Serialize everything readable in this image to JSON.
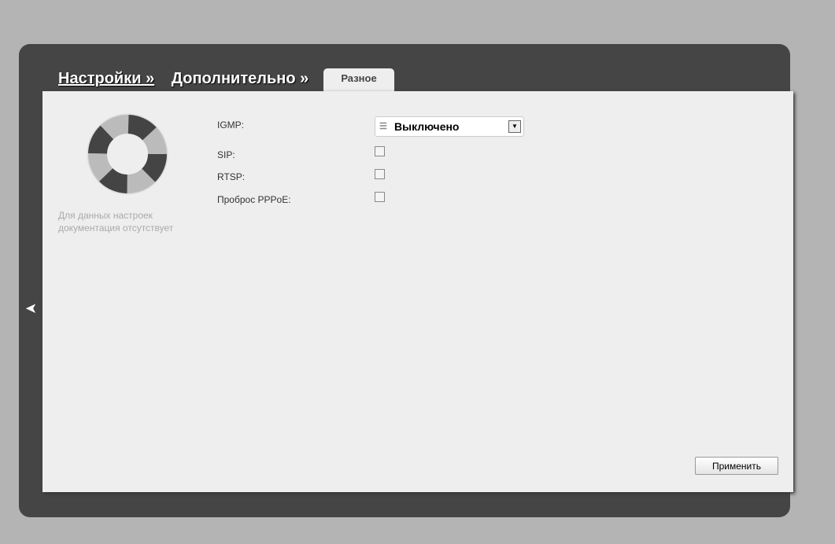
{
  "breadcrumb": {
    "item1": "Настройки »",
    "item2": "Дополнительно »"
  },
  "tab": "Разное",
  "help_note": "Для данных настроек документация отсутствует",
  "form": {
    "igmp_label": "IGMP:",
    "igmp_value": "Выключено",
    "sip_label": "SIP:",
    "rtsp_label": "RTSP:",
    "pppoe_label": "Проброс PPPoE:"
  },
  "apply_label": "Применить"
}
